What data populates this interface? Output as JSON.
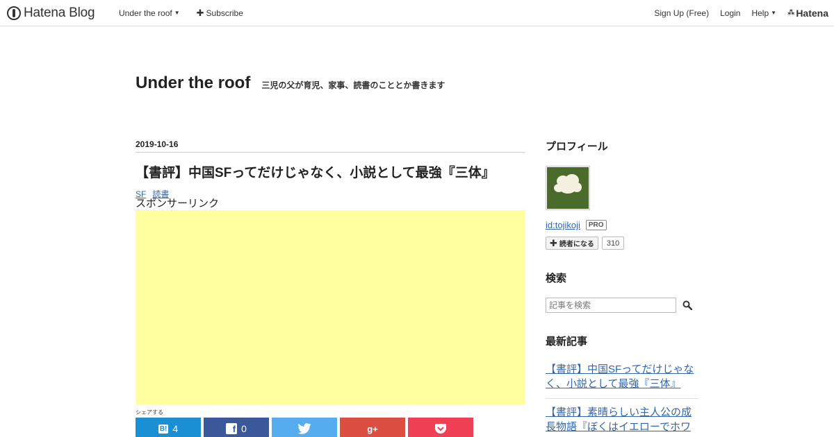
{
  "global_header": {
    "logo_text": "Hatena Blog",
    "blog_menu_label": "Under the roof",
    "subscribe_label": "Subscribe",
    "signup_label": "Sign Up (Free)",
    "login_label": "Login",
    "help_label": "Help",
    "hatena_label": "Hatena"
  },
  "blog": {
    "title": "Under the roof",
    "description": "三児の父が育児、家事、読書のこととか書きます"
  },
  "entry": {
    "date": "2019-10-16",
    "title": "【書評】中国SFってだけじゃなく、小説として最強『三体』",
    "categories": [
      "SF",
      "読書"
    ],
    "sponsor_label": "スポンサーリンク",
    "share_label": "シェアする",
    "share": {
      "hatena_count": "4",
      "facebook_count": "0"
    }
  },
  "sidebar": {
    "profile_heading": "プロフィール",
    "profile_id": "id:tojikoji",
    "pro_badge": "PRO",
    "follow_label": "読者になる",
    "follower_count": "310",
    "search_heading": "検索",
    "search_placeholder": "記事を検索",
    "recent_heading": "最新記事",
    "recent_entries": [
      "【書評】中国SFってだけじゃなく、小説として最強『三体』",
      "【書評】素晴らしい主人公の成長物語『ぼくはイエローでホワ"
    ]
  },
  "colors": {
    "link": "#3366aa",
    "ad_background": "#ffff9f",
    "hatena_bookmark": "#1b8fd3",
    "facebook": "#3b5998",
    "twitter": "#55acee",
    "google_plus": "#dc4e41",
    "pocket": "#ef4056"
  }
}
